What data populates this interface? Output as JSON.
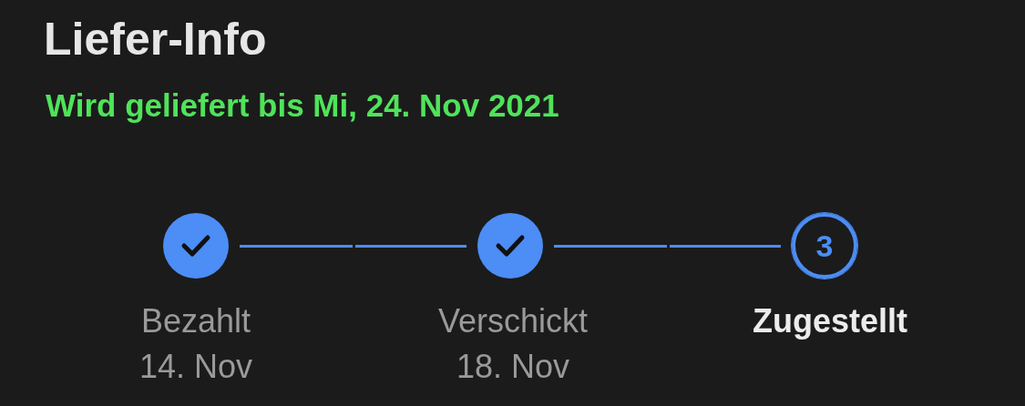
{
  "title": "Liefer-Info",
  "delivery_estimate": "Wird geliefert bis Mi, 24. Nov 2021",
  "steps": [
    {
      "label": "Bezahlt",
      "date": "14. Nov",
      "completed": true,
      "selected": false
    },
    {
      "label": "Verschickt",
      "date": "18. Nov",
      "completed": true,
      "selected": false
    },
    {
      "label": "Zugestellt",
      "number": "3",
      "completed": false,
      "selected": true
    }
  ]
}
